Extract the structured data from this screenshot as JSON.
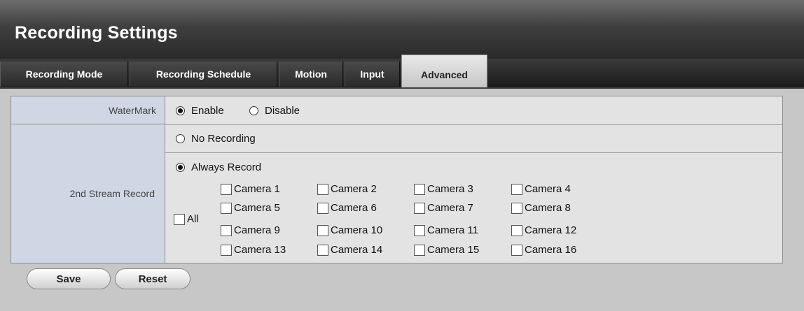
{
  "title": "Recording Settings",
  "tabs": [
    {
      "label": "Recording Mode"
    },
    {
      "label": "Recording Schedule"
    },
    {
      "label": "Motion"
    },
    {
      "label": "Input"
    },
    {
      "label": "Advanced",
      "active": true
    }
  ],
  "watermark": {
    "label": "WaterMark",
    "options": [
      {
        "label": "Enable",
        "checked": true
      },
      {
        "label": "Disable",
        "checked": false
      }
    ]
  },
  "stream": {
    "label": "2nd Stream Record",
    "no_recording": {
      "label": "No Recording",
      "checked": false
    },
    "always_record": {
      "label": "Always Record",
      "checked": true
    },
    "all_label": "All",
    "cameras": [
      "Camera 1",
      "Camera 2",
      "Camera 3",
      "Camera 4",
      "Camera 5",
      "Camera 6",
      "Camera 7",
      "Camera 8",
      "Camera 9",
      "Camera 10",
      "Camera 11",
      "Camera 12",
      "Camera 13",
      "Camera 14",
      "Camera 15",
      "Camera 16"
    ]
  },
  "buttons": {
    "save": "Save",
    "reset": "Reset"
  }
}
